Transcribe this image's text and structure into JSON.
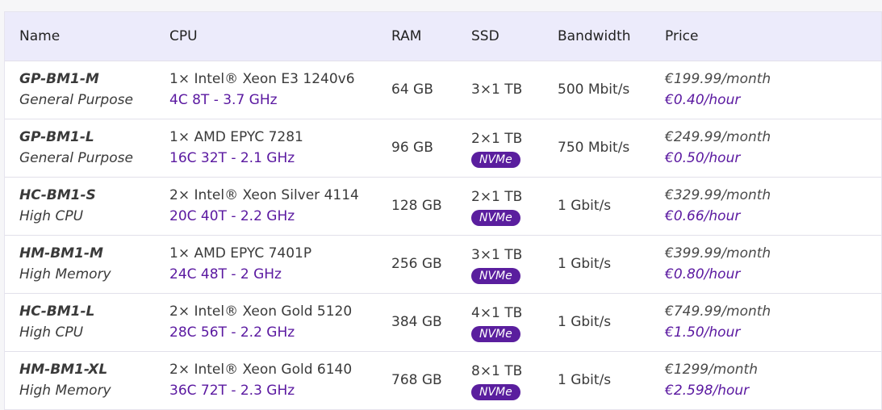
{
  "headers": {
    "name": "Name",
    "cpu": "CPU",
    "ram": "RAM",
    "ssd": "SSD",
    "bandwidth": "Bandwidth",
    "price": "Price"
  },
  "rows": [
    {
      "code": "GP-BM1-M",
      "category": "General Purpose",
      "cpu_model": "1× Intel® Xeon E3 1240v6",
      "cpu_spec": "4C 8T - 3.7 GHz",
      "ram": "64 GB",
      "ssd": "3×1 TB",
      "nvme": "",
      "bandwidth": "500 Mbit/s",
      "price_month": "€199.99/month",
      "price_hour": "€0.40/hour"
    },
    {
      "code": "GP-BM1-L",
      "category": "General Purpose",
      "cpu_model": "1× AMD EPYC 7281",
      "cpu_spec": "16C 32T - 2.1 GHz",
      "ram": "96 GB",
      "ssd": "2×1 TB",
      "nvme": "NVMe",
      "bandwidth": "750 Mbit/s",
      "price_month": "€249.99/month",
      "price_hour": "€0.50/hour"
    },
    {
      "code": "HC-BM1-S",
      "category": "High CPU",
      "cpu_model": "2× Intel® Xeon Silver 4114",
      "cpu_spec": "20C 40T - 2.2 GHz",
      "ram": "128 GB",
      "ssd": "2×1 TB",
      "nvme": "NVMe",
      "bandwidth": "1 Gbit/s",
      "price_month": "€329.99/month",
      "price_hour": "€0.66/hour"
    },
    {
      "code": "HM-BM1-M",
      "category": "High Memory",
      "cpu_model": "1× AMD EPYC 7401P",
      "cpu_spec": "24C 48T - 2 GHz",
      "ram": "256 GB",
      "ssd": "3×1 TB",
      "nvme": "NVMe",
      "bandwidth": "1 Gbit/s",
      "price_month": "€399.99/month",
      "price_hour": "€0.80/hour"
    },
    {
      "code": "HC-BM1-L",
      "category": "High CPU",
      "cpu_model": "2× Intel® Xeon Gold 5120",
      "cpu_spec": "28C 56T - 2.2 GHz",
      "ram": "384 GB",
      "ssd": "4×1 TB",
      "nvme": "NVMe",
      "bandwidth": "1 Gbit/s",
      "price_month": "€749.99/month",
      "price_hour": "€1.50/hour"
    },
    {
      "code": "HM-BM1-XL",
      "category": "High Memory",
      "cpu_model": "2× Intel® Xeon Gold 6140",
      "cpu_spec": "36C 72T - 2.3 GHz",
      "ram": "768 GB",
      "ssd": "8×1 TB",
      "nvme": "NVMe",
      "bandwidth": "1 Gbit/s",
      "price_month": "€1299/month",
      "price_hour": "€2.598/hour"
    }
  ],
  "colors": {
    "header_bg": "#ecebfb",
    "accent_purple": "#5a18a0",
    "badge_bg": "#5a1e9e"
  }
}
